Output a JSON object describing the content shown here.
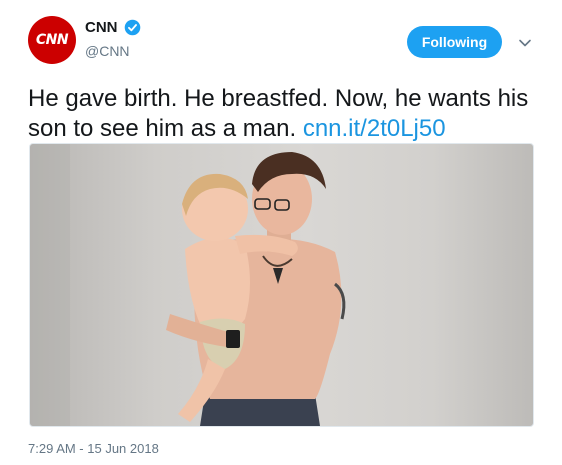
{
  "account": {
    "avatar_text": "CNN",
    "display_name": "CNN",
    "handle": "@CNN",
    "verified": true
  },
  "follow_button": {
    "label": "Following"
  },
  "tweet": {
    "text": "He gave birth. He breastfed. Now, he wants his son to see him as a man.",
    "link": "cnn.it/2t0Lj50"
  },
  "media": {
    "alt": "Photo of a shirtless man with an undercut hairstyle and glasses holding and kissing a toddler against a gray wall"
  },
  "meta": {
    "timestamp": "7:29 AM - 15 Jun 2018"
  },
  "colors": {
    "accent": "#1da1f2",
    "brand": "#cc0000",
    "link": "#1b95e0",
    "muted": "#657786"
  },
  "icons": {
    "verified": "verified-badge-icon",
    "more": "chevron-down-icon"
  }
}
